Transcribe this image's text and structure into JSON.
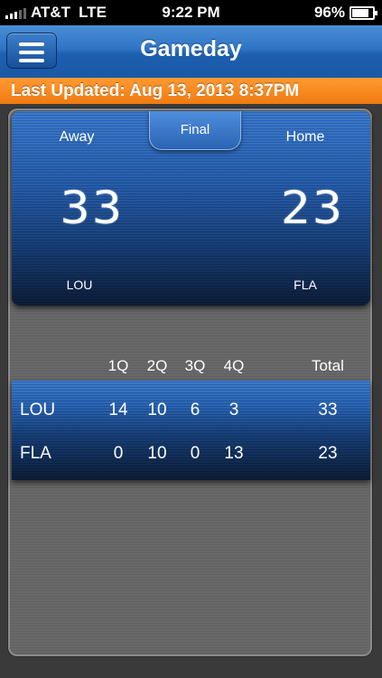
{
  "status_bar": {
    "carrier": "AT&T",
    "network": "LTE",
    "time": "9:22 PM",
    "battery": "96%"
  },
  "nav": {
    "menu_icon": "hamburger-menu-icon",
    "title": "Gameday"
  },
  "banner": {
    "last_updated": "Last Updated: Aug 13, 2013 8:37PM"
  },
  "scoreboard": {
    "status": "Final",
    "away_label": "Away",
    "home_label": "Home",
    "away_score": "33",
    "home_score": "23",
    "away_team": "LOU",
    "home_team": "FLA"
  },
  "linescore": {
    "headers": [
      "1Q",
      "2Q",
      "3Q",
      "4Q",
      "Total"
    ],
    "rows": [
      {
        "team": "LOU",
        "q1": "14",
        "q2": "10",
        "q3": "6",
        "q4": "3",
        "total": "33"
      },
      {
        "team": "FLA",
        "q1": "0",
        "q2": "10",
        "q3": "0",
        "q4": "13",
        "total": "23"
      }
    ]
  },
  "colors": {
    "nav_blue": "#2f74c4",
    "banner_orange": "#f07a10",
    "background_gray": "#616161"
  }
}
